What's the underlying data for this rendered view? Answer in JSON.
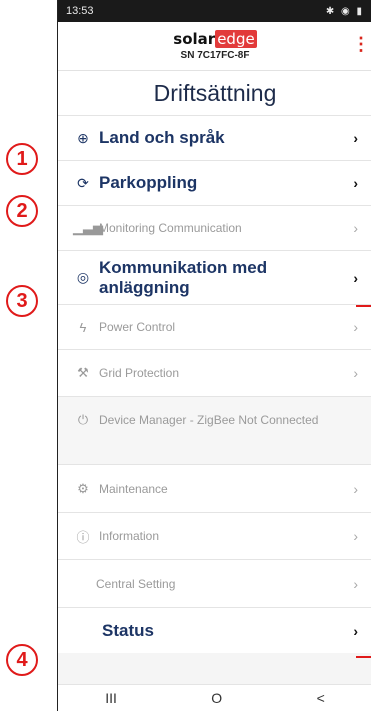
{
  "status_bar": {
    "time": "13:53",
    "icons": "✱ ◉ ▮"
  },
  "header": {
    "brand_left": "solar",
    "brand_right": "edge",
    "serial": "SN 7C17FC-8F",
    "menu_icon": "kebab-menu-icon"
  },
  "page": {
    "title": "Driftsättning"
  },
  "menu": [
    {
      "label": "Land och språk",
      "icon": "globe-icon"
    },
    {
      "label": "Parkoppling",
      "icon": "sync-icon"
    },
    {
      "label": "Monitoring Communication",
      "icon": "signal-bars-icon"
    },
    {
      "label": "Kommunikation med anläggning",
      "icon": "location-pin-icon"
    },
    {
      "label": "Power Control",
      "icon": "lightning-icon"
    },
    {
      "label": "Grid Protection",
      "icon": "pylon-icon"
    },
    {
      "label": "Device Manager - ZigBee Not Connected",
      "icon": "plug-icon"
    },
    {
      "label": "Maintenance",
      "icon": "wrench-icon"
    },
    {
      "label": "Information",
      "icon": "info-icon"
    },
    {
      "label": "Central Setting",
      "icon": ""
    },
    {
      "label": "Status",
      "icon": ""
    }
  ],
  "annotations": [
    "1",
    "2",
    "3",
    "4"
  ],
  "nav": {
    "recents": "III",
    "home": "O",
    "back": "<"
  },
  "colors": {
    "accent": "#e01a1a",
    "brand_red": "#e23a3a",
    "title": "#1d2b4a"
  }
}
